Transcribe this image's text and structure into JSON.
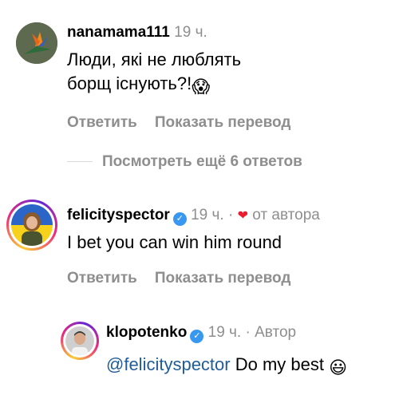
{
  "comments": [
    {
      "username": "nanamama111",
      "time": "19 ч.",
      "text": "Люди, які не люблять борщ існують?!",
      "emoji": "😱",
      "reply_label": "Ответить",
      "translate_label": "Показать перевод"
    },
    {
      "username": "felicityspector",
      "time": "19 ч.",
      "separator": "·",
      "liked_by_author": "от автора",
      "text": "I bet you can win him round",
      "reply_label": "Ответить",
      "translate_label": "Показать перевод"
    },
    {
      "username": "klopotenko",
      "time": "19 ч.",
      "separator": "·",
      "author_badge": "Автор",
      "mention": "@felicityspector",
      "text": "Do my best",
      "emoji": "😃"
    }
  ],
  "view_replies_label": "Посмотреть ещё 6 ответов",
  "colors": {
    "secondary": "#8e8e8e",
    "verified": "#3897f0",
    "heart": "#ed1b2e",
    "mention": "#1f5c99"
  }
}
